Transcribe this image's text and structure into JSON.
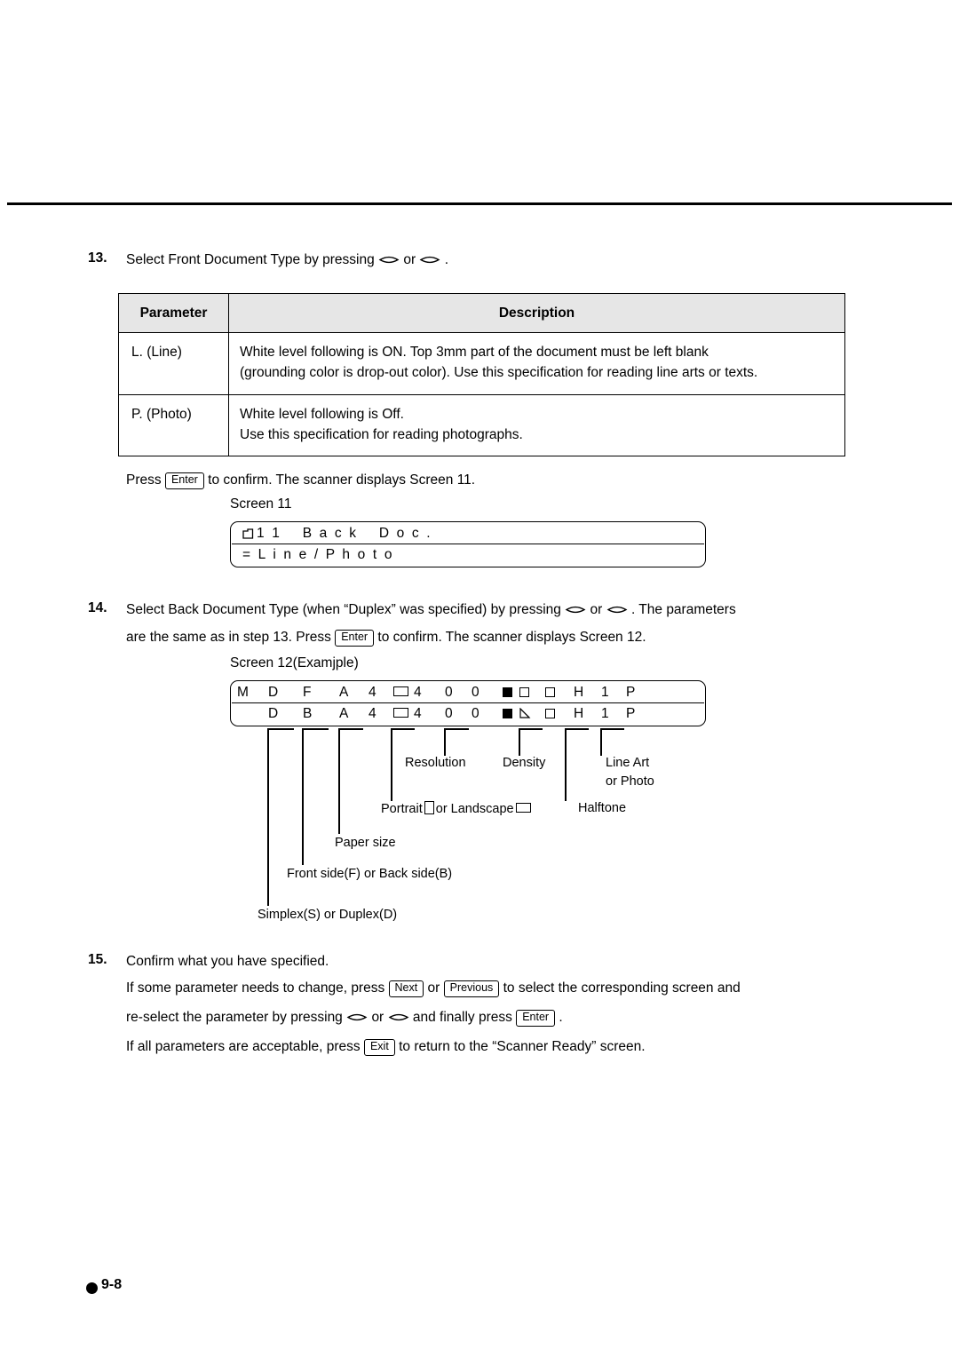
{
  "page": {
    "footer_label": "9-8"
  },
  "step13": {
    "number": "13.",
    "text_before": "Select Front Document Type by pressing",
    "or": "or",
    "text_after": ".",
    "table": {
      "headers": [
        "Parameter",
        "Description"
      ],
      "rows": [
        {
          "parameter": "L. (Line)",
          "description_line1": "White level following is ON. Top 3mm part of the document must be left blank",
          "description_line2": "(grounding color is drop-out color). Use this specification for reading line arts or texts."
        },
        {
          "parameter": "P. (Photo)",
          "description_line1": "White level following is Off.",
          "description_line2": "Use this specification for reading photographs."
        }
      ]
    },
    "press_prefix": "Press",
    "enter_key": "Enter",
    "press_suffix": "to confirm. The scanner displays Screen 11.",
    "screen_caption": "Screen 11",
    "screen_line1": "1  1      B  a  c  k      D  o  c  .",
    "screen_line2": "=  L  i  n  e  /  P  h  o  t  o"
  },
  "step14": {
    "number": "14.",
    "line1_a": "Select Back Document Type (when “Duplex” was specified) by pressing",
    "or": "or",
    "line1_b": ". The parameters",
    "line2_a": "are the same as in step 13. Press",
    "enter_key": "Enter",
    "line2_b": "to confirm. The scanner displays Screen 12.",
    "screen_caption": "Screen 12(Examjple)",
    "screen_row1": [
      "M",
      "D",
      "F",
      "A",
      "4",
      "▭",
      "4",
      "0",
      "0",
      "■",
      "□",
      "□",
      "H",
      "1",
      "P"
    ],
    "screen_row2": [
      "",
      "D",
      "B",
      "A",
      "4",
      "▭",
      "4",
      "0",
      "0",
      "■",
      "◢",
      "□",
      "H",
      "1",
      "P"
    ],
    "callouts": {
      "resolution": "Resolution",
      "density": "Density",
      "line_art_1": "Line Art",
      "line_art_2": "or Photo",
      "orientation_a": "Portrait",
      "orientation_b": "or Landscape",
      "halftone": "Halftone",
      "paper_size": "Paper size",
      "side": "Front side(F) or Back side(B)",
      "mode": "Simplex(S) or Duplex(D)"
    }
  },
  "step15": {
    "number": "15.",
    "line1": "Confirm what you have specified.",
    "line2_a": "If some parameter needs to change, press",
    "next_key": "Next",
    "or": "or",
    "previous_key": "Previous",
    "line2_b": "to select the corresponding screen and",
    "line3_a": "re-select the parameter by pressing",
    "line3_b": "and finally press",
    "enter_key": "Enter",
    "line3_c": ".",
    "line4_a": "If all parameters are acceptable, press",
    "exit_key": "Exit",
    "line4_b": "to return to the “Scanner Ready” screen."
  }
}
